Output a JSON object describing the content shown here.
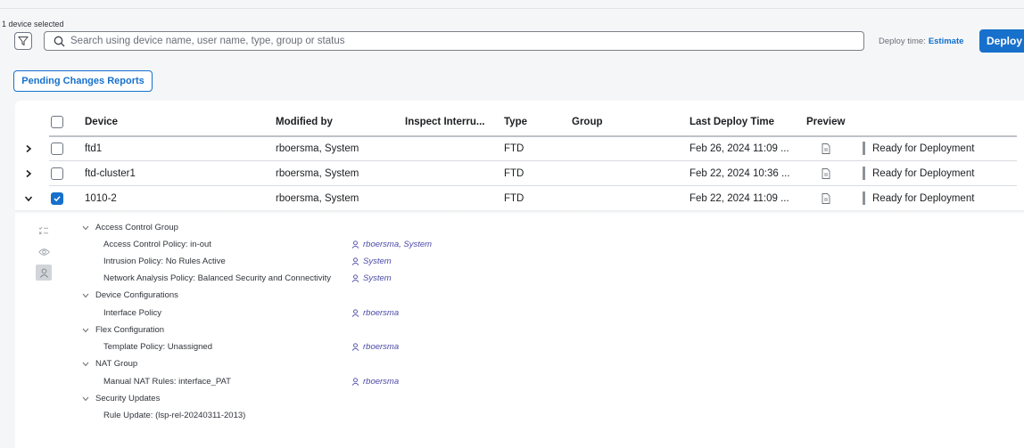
{
  "selection": {
    "count_text": "1 device selected"
  },
  "search": {
    "placeholder": "Search using device name, user name, type, group or status"
  },
  "deploy": {
    "time_label": "Deploy time:",
    "estimate_label": "Estimate",
    "button_label": "Deploy"
  },
  "pending_button_label": "Pending Changes Reports",
  "table": {
    "columns": [
      "Device",
      "Modified by",
      "Inspect Interru...",
      "Type",
      "Group",
      "Last Deploy Time",
      "Preview"
    ],
    "rows": [
      {
        "device": "ftd1",
        "modified_by": "rboersma, System",
        "inspect": "",
        "type": "FTD",
        "group": "",
        "last_deploy": "Feb 26, 2024 11:09 ...",
        "status": "Ready for Deployment",
        "expanded": false,
        "checked": false
      },
      {
        "device": "ftd-cluster1",
        "modified_by": "rboersma, System",
        "inspect": "",
        "type": "FTD",
        "group": "",
        "last_deploy": "Feb 22, 2024 10:36 ...",
        "status": "Ready for Deployment",
        "expanded": false,
        "checked": false
      },
      {
        "device": "1010-2",
        "modified_by": "rboersma, System",
        "inspect": "",
        "type": "FTD",
        "group": "",
        "last_deploy": "Feb 22, 2024 11:09 ...",
        "status": "Ready for Deployment",
        "expanded": true,
        "checked": true
      }
    ]
  },
  "details": {
    "groups": [
      {
        "label": "Access Control Group",
        "items": [
          {
            "label": "Access Control Policy: in-out",
            "user": "rboersma, System"
          },
          {
            "label": "Intrusion Policy: No Rules Active",
            "user": "System"
          },
          {
            "label": "Network Analysis Policy: Balanced Security and Connectivity",
            "user": "System"
          }
        ]
      },
      {
        "label": "Device Configurations",
        "items": [
          {
            "label": "Interface Policy",
            "user": "rboersma"
          }
        ]
      },
      {
        "label": "Flex Configuration",
        "items": [
          {
            "label": "Template Policy: Unassigned",
            "user": "rboersma"
          }
        ]
      },
      {
        "label": "NAT Group",
        "items": [
          {
            "label": "Manual NAT Rules: interface_PAT",
            "user": "rboersma"
          }
        ]
      },
      {
        "label": "Security Updates",
        "items": [
          {
            "label": "Rule Update: (lsp-rel-20240311-2013)",
            "user": ""
          }
        ]
      }
    ]
  },
  "icons": {
    "filter": "filter-icon",
    "search": "search-icon",
    "expand": "chevron-right-icon",
    "collapse": "chevron-down-icon",
    "preview": "document-icon",
    "side_checklist": "checklist-icon",
    "side_eye": "eye-icon",
    "side_user": "user-icon"
  },
  "colors": {
    "accent": "#1670cc",
    "user_link": "#4b4aa7",
    "status_bar": "#8d939b"
  }
}
